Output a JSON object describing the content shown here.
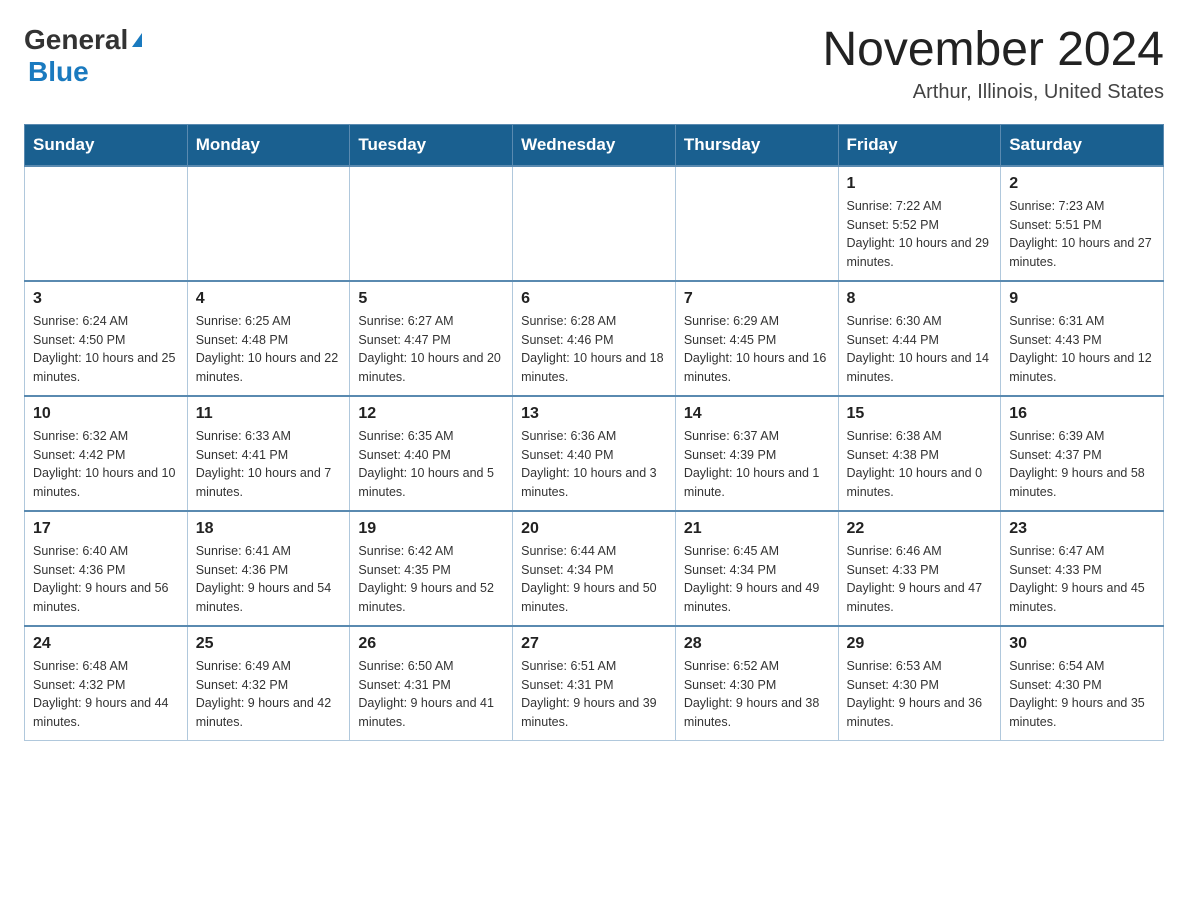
{
  "header": {
    "logo_general": "General",
    "logo_blue": "Blue",
    "month_title": "November 2024",
    "location": "Arthur, Illinois, United States"
  },
  "days_of_week": [
    "Sunday",
    "Monday",
    "Tuesday",
    "Wednesday",
    "Thursday",
    "Friday",
    "Saturday"
  ],
  "weeks": [
    [
      {
        "day": "",
        "info": ""
      },
      {
        "day": "",
        "info": ""
      },
      {
        "day": "",
        "info": ""
      },
      {
        "day": "",
        "info": ""
      },
      {
        "day": "",
        "info": ""
      },
      {
        "day": "1",
        "info": "Sunrise: 7:22 AM\nSunset: 5:52 PM\nDaylight: 10 hours and 29 minutes."
      },
      {
        "day": "2",
        "info": "Sunrise: 7:23 AM\nSunset: 5:51 PM\nDaylight: 10 hours and 27 minutes."
      }
    ],
    [
      {
        "day": "3",
        "info": "Sunrise: 6:24 AM\nSunset: 4:50 PM\nDaylight: 10 hours and 25 minutes."
      },
      {
        "day": "4",
        "info": "Sunrise: 6:25 AM\nSunset: 4:48 PM\nDaylight: 10 hours and 22 minutes."
      },
      {
        "day": "5",
        "info": "Sunrise: 6:27 AM\nSunset: 4:47 PM\nDaylight: 10 hours and 20 minutes."
      },
      {
        "day": "6",
        "info": "Sunrise: 6:28 AM\nSunset: 4:46 PM\nDaylight: 10 hours and 18 minutes."
      },
      {
        "day": "7",
        "info": "Sunrise: 6:29 AM\nSunset: 4:45 PM\nDaylight: 10 hours and 16 minutes."
      },
      {
        "day": "8",
        "info": "Sunrise: 6:30 AM\nSunset: 4:44 PM\nDaylight: 10 hours and 14 minutes."
      },
      {
        "day": "9",
        "info": "Sunrise: 6:31 AM\nSunset: 4:43 PM\nDaylight: 10 hours and 12 minutes."
      }
    ],
    [
      {
        "day": "10",
        "info": "Sunrise: 6:32 AM\nSunset: 4:42 PM\nDaylight: 10 hours and 10 minutes."
      },
      {
        "day": "11",
        "info": "Sunrise: 6:33 AM\nSunset: 4:41 PM\nDaylight: 10 hours and 7 minutes."
      },
      {
        "day": "12",
        "info": "Sunrise: 6:35 AM\nSunset: 4:40 PM\nDaylight: 10 hours and 5 minutes."
      },
      {
        "day": "13",
        "info": "Sunrise: 6:36 AM\nSunset: 4:40 PM\nDaylight: 10 hours and 3 minutes."
      },
      {
        "day": "14",
        "info": "Sunrise: 6:37 AM\nSunset: 4:39 PM\nDaylight: 10 hours and 1 minute."
      },
      {
        "day": "15",
        "info": "Sunrise: 6:38 AM\nSunset: 4:38 PM\nDaylight: 10 hours and 0 minutes."
      },
      {
        "day": "16",
        "info": "Sunrise: 6:39 AM\nSunset: 4:37 PM\nDaylight: 9 hours and 58 minutes."
      }
    ],
    [
      {
        "day": "17",
        "info": "Sunrise: 6:40 AM\nSunset: 4:36 PM\nDaylight: 9 hours and 56 minutes."
      },
      {
        "day": "18",
        "info": "Sunrise: 6:41 AM\nSunset: 4:36 PM\nDaylight: 9 hours and 54 minutes."
      },
      {
        "day": "19",
        "info": "Sunrise: 6:42 AM\nSunset: 4:35 PM\nDaylight: 9 hours and 52 minutes."
      },
      {
        "day": "20",
        "info": "Sunrise: 6:44 AM\nSunset: 4:34 PM\nDaylight: 9 hours and 50 minutes."
      },
      {
        "day": "21",
        "info": "Sunrise: 6:45 AM\nSunset: 4:34 PM\nDaylight: 9 hours and 49 minutes."
      },
      {
        "day": "22",
        "info": "Sunrise: 6:46 AM\nSunset: 4:33 PM\nDaylight: 9 hours and 47 minutes."
      },
      {
        "day": "23",
        "info": "Sunrise: 6:47 AM\nSunset: 4:33 PM\nDaylight: 9 hours and 45 minutes."
      }
    ],
    [
      {
        "day": "24",
        "info": "Sunrise: 6:48 AM\nSunset: 4:32 PM\nDaylight: 9 hours and 44 minutes."
      },
      {
        "day": "25",
        "info": "Sunrise: 6:49 AM\nSunset: 4:32 PM\nDaylight: 9 hours and 42 minutes."
      },
      {
        "day": "26",
        "info": "Sunrise: 6:50 AM\nSunset: 4:31 PM\nDaylight: 9 hours and 41 minutes."
      },
      {
        "day": "27",
        "info": "Sunrise: 6:51 AM\nSunset: 4:31 PM\nDaylight: 9 hours and 39 minutes."
      },
      {
        "day": "28",
        "info": "Sunrise: 6:52 AM\nSunset: 4:30 PM\nDaylight: 9 hours and 38 minutes."
      },
      {
        "day": "29",
        "info": "Sunrise: 6:53 AM\nSunset: 4:30 PM\nDaylight: 9 hours and 36 minutes."
      },
      {
        "day": "30",
        "info": "Sunrise: 6:54 AM\nSunset: 4:30 PM\nDaylight: 9 hours and 35 minutes."
      }
    ]
  ]
}
